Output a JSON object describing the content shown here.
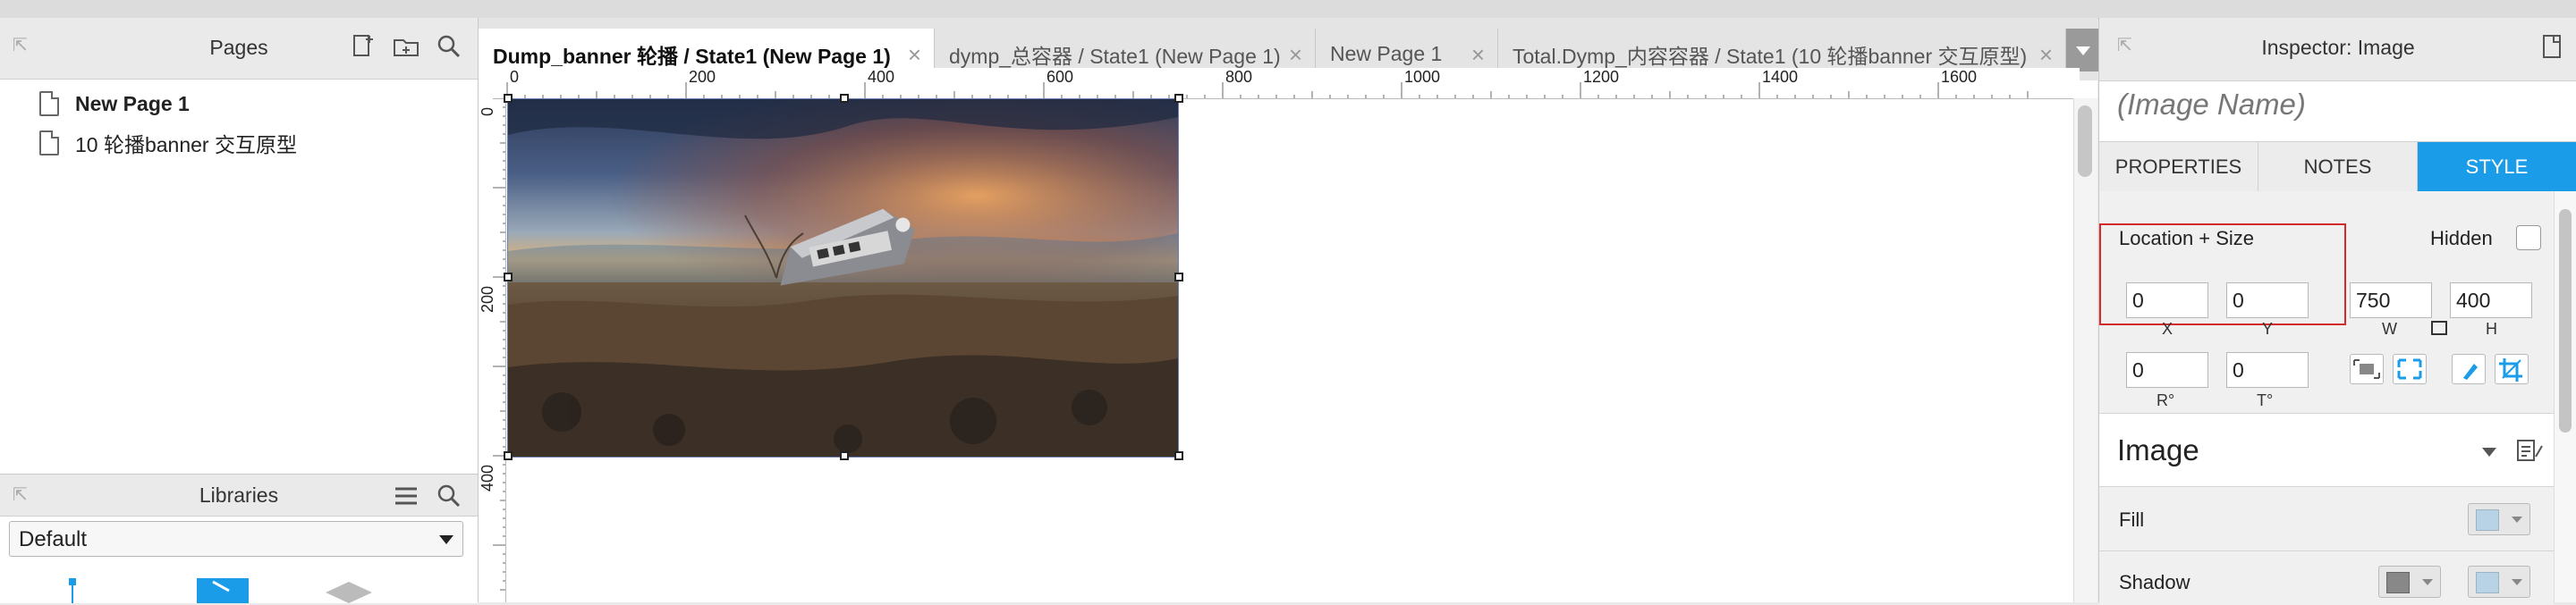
{
  "left_panel": {
    "pages_title": "Pages",
    "pages": [
      {
        "label": "New Page 1"
      },
      {
        "label": "10 轮播banner 交互原型"
      }
    ],
    "libraries_title": "Libraries",
    "library_selected": "Default"
  },
  "tabs": [
    {
      "label": "Dump_banner 轮播 / State1 (New Page 1)"
    },
    {
      "label": "dymp_总容器 / State1 (New Page 1)"
    },
    {
      "label": "New Page 1"
    },
    {
      "label": "Total.Dymp_内容容器 / State1 (10 轮播banner 交互原型)"
    }
  ],
  "ruler": {
    "top_labels": [
      "0",
      "200",
      "400",
      "600",
      "800",
      "1000",
      "1200",
      "1400",
      "1600"
    ],
    "left_labels": [
      "0",
      "200",
      "400"
    ]
  },
  "inspector": {
    "title": "Inspector: Image",
    "image_name_placeholder": "(Image Name)",
    "tabs": [
      "PROPERTIES",
      "NOTES",
      "STYLE"
    ],
    "active_tab": "STYLE",
    "location_size_label": "Location + Size",
    "hidden_label": "Hidden",
    "x": "0",
    "y": "0",
    "w": "750",
    "h": "400",
    "r": "0",
    "t": "0",
    "x_cap": "X",
    "y_cap": "Y",
    "w_cap": "W",
    "h_cap": "H",
    "r_cap": "R°",
    "t_cap": "T°",
    "image_section": "Image",
    "fill_label": "Fill",
    "shadow_label": "Shadow"
  },
  "colors": {
    "accent": "#1b9ce8",
    "highlight_box": "#d52a2a"
  }
}
